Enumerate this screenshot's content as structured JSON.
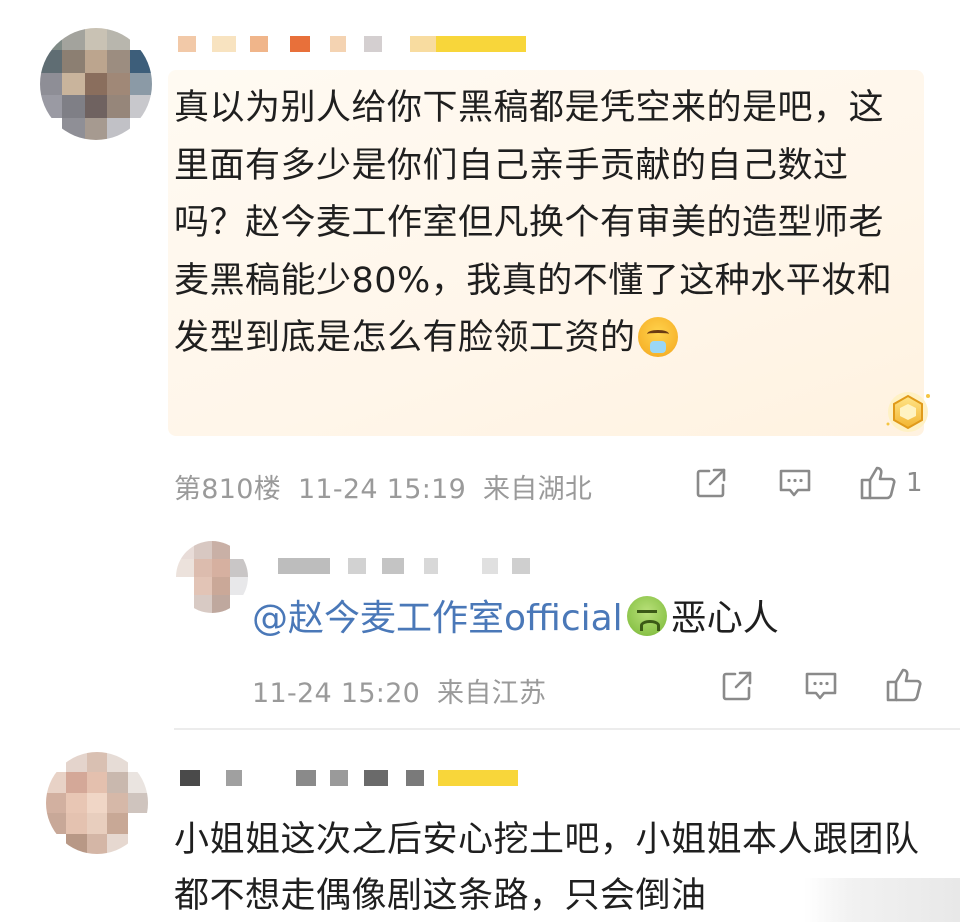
{
  "comment1": {
    "text": "真以为别人给你下黑稿都是凭空来的是吧，这里面有多少是你们自己亲手贡献的自己数过吗？赵今麦工作室但凡换个有审美的造型师老麦黑稿能少80%，我真的不懂了这种水平妆和发型到底是怎么有脸领工资的",
    "emoji": "tired-face-emoji",
    "floor": "第810楼",
    "time": "11-24 15:19",
    "location": "来自湖北",
    "like_count": "1"
  },
  "reply": {
    "mention": "@赵今麦工作室official",
    "emoji": "nauseated-face-emoji",
    "text": "恶心人",
    "time": "11-24 15:20",
    "location": "来自江苏"
  },
  "comment3": {
    "text": "小姐姐这次之后安心挖土吧，小姐姐本人跟团队都不想走偶像剧这条路，只会倒油"
  },
  "icons": {
    "share": "share-icon",
    "comment": "comment-icon",
    "like": "thumb-up-icon",
    "badge": "star-badge-icon"
  },
  "colors": {
    "mention": "#4a78b8",
    "meta": "#9a9a9a",
    "comment_bg": "#fff6ea"
  }
}
